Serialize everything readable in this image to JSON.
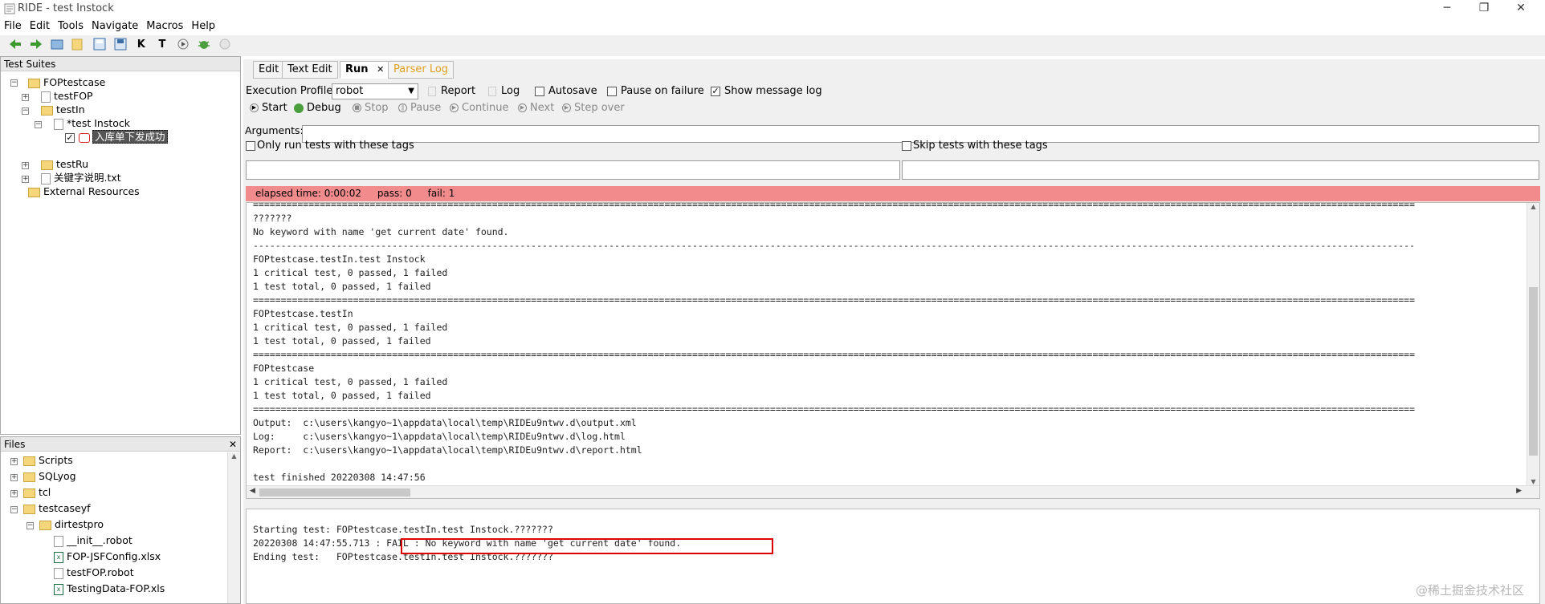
{
  "window": {
    "title": "RIDE - test Instock",
    "minimize": "─",
    "restore": "❐",
    "close": "✕"
  },
  "menu": [
    "File",
    "Edit",
    "Tools",
    "Navigate",
    "Macros",
    "Help"
  ],
  "toolbar_icons": [
    "back-arrow-icon",
    "forward-arrow-icon",
    "open-suite-icon",
    "open-directory-icon",
    "save-icon",
    "save-all-icon",
    "keyword-search-icon",
    "text-search-icon",
    "run-icon",
    "debug-icon",
    "stop-icon"
  ],
  "toolbar_glyphs": {
    "k": "K",
    "t": "T"
  },
  "suites": {
    "header": "Test Suites",
    "tree": [
      {
        "label": "FOPtestcase"
      },
      {
        "label": "testFOP"
      },
      {
        "label": "testIn"
      },
      {
        "label": "*test Instock"
      },
      {
        "label": "入库单下发成功"
      },
      {
        "label": "testRu"
      },
      {
        "label": "关键字说明.txt"
      },
      {
        "label": "External Resources"
      }
    ]
  },
  "files": {
    "header": "Files",
    "close": "✕",
    "items": [
      "Scripts",
      "SQLyog",
      "tcl",
      "testcaseyf",
      "dirtestpro",
      "__init__.robot",
      "FOP-JSFConfig.xlsx",
      "testFOP.robot",
      "TestingData-FOP.xls"
    ]
  },
  "tabs": [
    "Edit",
    "Text Edit",
    "Run",
    "Parser Log"
  ],
  "tab_close": "✕",
  "run": {
    "profile_label": "Execution Profile:",
    "profile_value": "robot",
    "report": "Report",
    "log": "Log",
    "autosave": "Autosave",
    "pause_on_failure": "Pause on failure",
    "show_message_log": "Show message log",
    "start": "Start",
    "debug": "Debug",
    "stop": "Stop",
    "pause": "Pause",
    "continue": "Continue",
    "next": "Next",
    "step_over": "Step over",
    "arguments_label": "Arguments:",
    "only_run_tags": "Only run tests with these tags",
    "skip_tags": "Skip tests with these tags",
    "checked_mark": "✓",
    "status": {
      "elapsed": "elapsed time: 0:00:02",
      "pass": "pass: 0",
      "fail": "fail: 1"
    }
  },
  "console_lines": [
    "=================================================================================================================================================================================================================",
    "???????",
    "No keyword with name 'get current date' found.",
    "-----------------------------------------------------------------------------------------------------------------------------------------------------------------------------------------------------------------",
    "FOPtestcase.testIn.test Instock",
    "1 critical test, 0 passed, 1 failed",
    "1 test total, 0 passed, 1 failed",
    "=================================================================================================================================================================================================================",
    "FOPtestcase.testIn",
    "1 critical test, 0 passed, 1 failed",
    "1 test total, 0 passed, 1 failed",
    "=================================================================================================================================================================================================================",
    "FOPtestcase",
    "1 critical test, 0 passed, 1 failed",
    "1 test total, 0 passed, 1 failed",
    "=================================================================================================================================================================================================================",
    "Output:  c:\\users\\kangyo~1\\appdata\\local\\temp\\RIDEu9ntwv.d\\output.xml",
    "Log:     c:\\users\\kangyo~1\\appdata\\local\\temp\\RIDEu9ntwv.d\\log.html",
    "Report:  c:\\users\\kangyo~1\\appdata\\local\\temp\\RIDEu9ntwv.d\\report.html",
    "",
    "test finished 20220308 14:47:56"
  ],
  "message_lines": [
    "Starting test: FOPtestcase.testIn.test Instock.???????",
    "20220308 14:47:55.713 : FAIL : No keyword with name 'get current date' found.",
    "Ending test:   FOPtestcase.testIn.test Instock.???????"
  ],
  "scroll_arrows": {
    "up": "▲",
    "down": "▼",
    "left": "◀",
    "right": "▶"
  },
  "watermark": "@稀土掘金技术社区",
  "colors": {
    "fail_bar": "#f28b8b",
    "highlight": "#e00000",
    "parser_log": "#e0a020"
  }
}
